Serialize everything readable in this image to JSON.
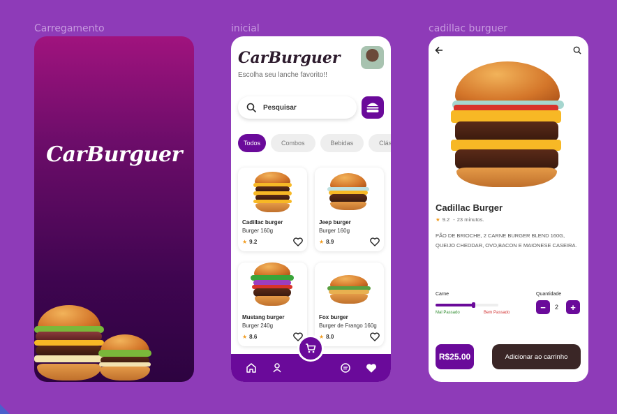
{
  "frames": {
    "splash_label": "Carregamento",
    "home_label": "inicial",
    "detail_label": "cadillac burguer"
  },
  "brand": {
    "logo": "CarBurguer",
    "accent": "#6a0a9a",
    "background": "#8e3bb8"
  },
  "home": {
    "subtitle": "Escolha seu lanche favorito!!",
    "search_placeholder": "Pesquisar",
    "categories": [
      "Todos",
      "Combos",
      "Bebidas",
      "Clás"
    ],
    "products": [
      {
        "name": "Cadillac burger",
        "desc": "Burger 160g",
        "rating": "9.2"
      },
      {
        "name": "Jeep burger",
        "desc": "Burger 160g",
        "rating": "8.9"
      },
      {
        "name": "Mustang burger",
        "desc": "Burger 240g",
        "rating": "8.6"
      },
      {
        "name": "Fox burger",
        "desc": "Burger de Frango 160g",
        "rating": "8.0"
      }
    ],
    "nav_icons": [
      "home-icon",
      "profile-icon",
      "cart-icon",
      "chat-icon",
      "heart-icon"
    ]
  },
  "detail": {
    "title": "Cadillac Burger",
    "rating": "9.2",
    "time": "23 minutos.",
    "description": "PÃO DE BRIOCHE, 2 CARNE BURGER BLEND 160G, QUEIJO CHEDDAR, OVO,BACON E MAIONESE CASEIRA.",
    "carne_label": "Carne",
    "doneness": 0.6,
    "mal_label": "Mal Passado",
    "bem_label": "Bem Passado",
    "qty_label": "Quantidade",
    "qty_minus": "−",
    "qty_value": "2",
    "qty_plus": "+",
    "price": "R$25.00",
    "add_button": "Adicionar ao carrinho"
  }
}
